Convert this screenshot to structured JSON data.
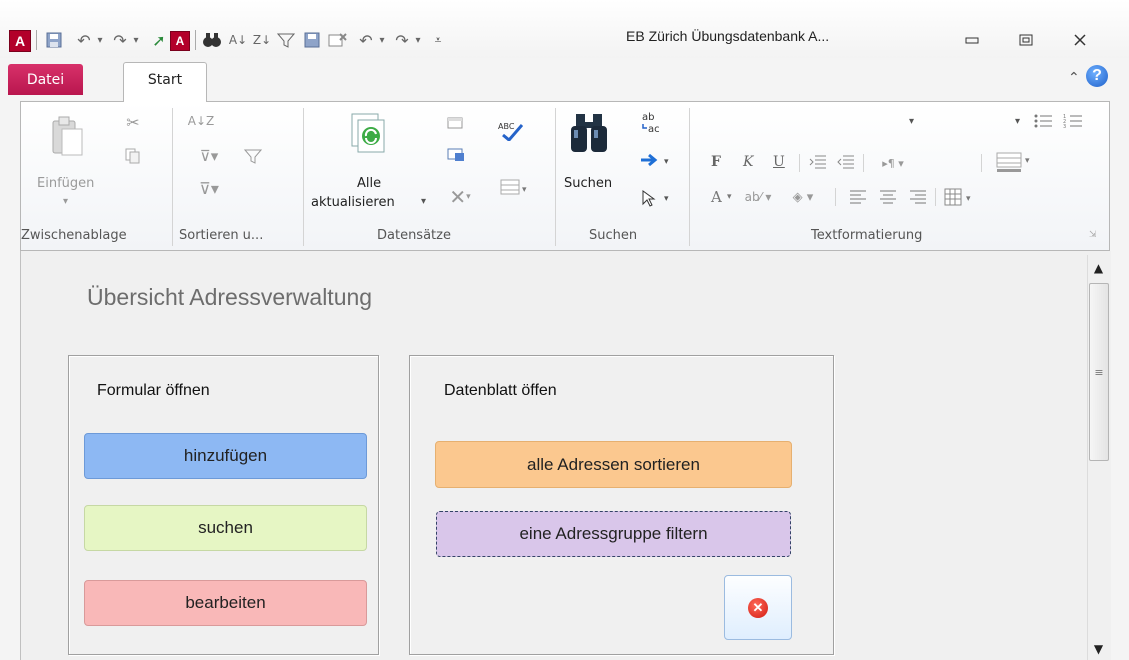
{
  "window": {
    "title": "EB Zürich Übungsdatenbank A...",
    "app_logo_letter": "A",
    "quick_access_icons": [
      "access-app-icon",
      "save-icon",
      "undo-icon",
      "redo-icon",
      "access-form-icon",
      "find-icon",
      "sort-ascending-icon",
      "sort-descending-icon",
      "filter-icon",
      "save-icon",
      "delete-icon",
      "undo-icon",
      "redo-icon",
      "customize-qat-icon"
    ],
    "controls": {
      "minimize": "▭",
      "maximize": "▣",
      "close": "✕"
    }
  },
  "tabs": [
    {
      "label": "Datei",
      "active": false
    },
    {
      "label": "Start",
      "active": true
    }
  ],
  "ribbon": {
    "groups": [
      {
        "label": "Zwischenablage",
        "buttons": {
          "paste": "Einfügen"
        }
      },
      {
        "label": "Sortieren u..."
      },
      {
        "label": "Datensätze",
        "buttons": {
          "refresh_line1": "Alle",
          "refresh_line2": "aktualisieren"
        }
      },
      {
        "label": "Suchen",
        "buttons": {
          "find": "Suchen"
        }
      },
      {
        "label": "Textformatierung",
        "buttons": {
          "bold": "F",
          "italic": "K",
          "underline": "U",
          "font_color": "A"
        }
      }
    ]
  },
  "form": {
    "title": "Übersicht Adressverwaltung",
    "left_panel": {
      "heading": "Formular öffnen",
      "buttons": [
        "hinzufügen",
        "suchen",
        "bearbeiten"
      ]
    },
    "right_panel": {
      "heading": "Datenblatt öffen",
      "buttons": [
        "alle Adressen sortieren",
        "eine Adressgruppe filtern"
      ],
      "close_icon": "close-form-icon"
    }
  },
  "colors": {
    "datei_tab": "#c2185b",
    "hinzufuegen": "#8db8f3",
    "suchen": "#e6f6c4",
    "bearbeiten": "#f9b8b8",
    "sortieren": "#fbc88f",
    "filtern": "#d9c6ea"
  }
}
